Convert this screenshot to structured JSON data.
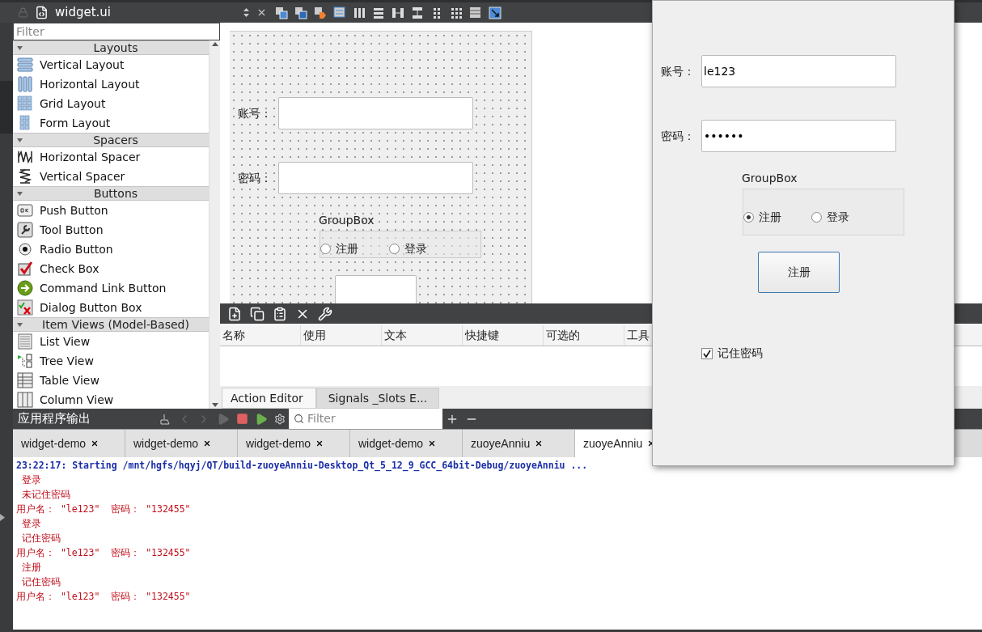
{
  "editor_bar": {
    "file": "widget.ui"
  },
  "widget_box": {
    "filter_placeholder": "Filter",
    "sections": [
      {
        "title": "Layouts",
        "expanded": true,
        "items": [
          {
            "label": "Vertical Layout",
            "kind": "vlayout"
          },
          {
            "label": "Horizontal Layout",
            "kind": "hlayout"
          },
          {
            "label": "Grid Layout",
            "kind": "grid"
          },
          {
            "label": "Form Layout",
            "kind": "form"
          }
        ]
      },
      {
        "title": "Spacers",
        "expanded": true,
        "items": [
          {
            "label": "Horizontal Spacer",
            "kind": "hspacer"
          },
          {
            "label": "Vertical Spacer",
            "kind": "vspacer"
          }
        ]
      },
      {
        "title": "Buttons",
        "expanded": true,
        "items": [
          {
            "label": "Push Button",
            "kind": "push"
          },
          {
            "label": "Tool Button",
            "kind": "tool"
          },
          {
            "label": "Radio Button",
            "kind": "radio"
          },
          {
            "label": "Check Box",
            "kind": "check"
          },
          {
            "label": "Command Link Button",
            "kind": "command"
          },
          {
            "label": "Dialog Button Box",
            "kind": "dialog"
          }
        ]
      },
      {
        "title": "Item Views (Model-Based)",
        "expanded": true,
        "items": [
          {
            "label": "List View",
            "kind": "list"
          },
          {
            "label": "Tree View",
            "kind": "tree"
          },
          {
            "label": "Table View",
            "kind": "table"
          },
          {
            "label": "Column View",
            "kind": "column"
          }
        ]
      }
    ]
  },
  "form_preview": {
    "fields": [
      {
        "label": "账号："
      },
      {
        "label": "密码："
      }
    ],
    "group_title": "GroupBox",
    "radios": [
      {
        "label": "注册",
        "selected": false
      },
      {
        "label": "登录",
        "selected": false
      }
    ]
  },
  "action_editor": {
    "columns": [
      "名称",
      "使用",
      "文本",
      "快捷键",
      "可选的",
      "工具"
    ],
    "tabs": [
      {
        "label": "Action Editor",
        "selected": true
      },
      {
        "label": "Signals _Slots E...",
        "selected": false
      }
    ]
  },
  "output_pane": {
    "title": "应用程序输出",
    "filter_placeholder": "Filter",
    "tabs": [
      {
        "label": "widget-demo",
        "selected": false
      },
      {
        "label": "widget-demo",
        "selected": false
      },
      {
        "label": "widget-demo",
        "selected": false
      },
      {
        "label": "widget-demo",
        "selected": false
      },
      {
        "label": "zuoyeAnniu",
        "selected": false
      },
      {
        "label": "zuoyeAnniu",
        "selected": true
      }
    ],
    "lines": [
      {
        "text": "23:22:17: Starting /mnt/hgfs/hqyj/QT/build-zuoyeAnniu-Desktop_Qt_5_12_9_GCC_64bit-Debug/zuoyeAnniu ...",
        "kind": "info"
      },
      {
        "text": " 登录",
        "kind": "out"
      },
      {
        "text": " 未记住密码",
        "kind": "out"
      },
      {
        "text": "用户名： \"le123\"  密码： \"132455\"",
        "kind": "out"
      },
      {
        "text": " 登录",
        "kind": "out"
      },
      {
        "text": " 记住密码",
        "kind": "out"
      },
      {
        "text": "用户名： \"le123\"  密码： \"132455\"",
        "kind": "out"
      },
      {
        "text": " 注册",
        "kind": "out"
      },
      {
        "text": " 记住密码",
        "kind": "out"
      },
      {
        "text": "用户名： \"le123\"  密码： \"132455\"",
        "kind": "out"
      }
    ]
  },
  "login_window": {
    "fields": [
      {
        "label": "账号：",
        "value": "le123"
      },
      {
        "label": "密码：",
        "value": "••••••"
      }
    ],
    "group_title": "GroupBox",
    "radios": [
      {
        "label": "注册",
        "selected": true
      },
      {
        "label": "登录",
        "selected": false
      }
    ],
    "button": "注册",
    "remember": {
      "label": "记住密码",
      "checked": true
    }
  }
}
